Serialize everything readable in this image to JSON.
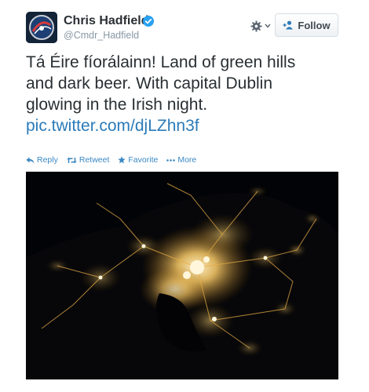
{
  "tweet": {
    "user": {
      "name": "Chris Hadfield",
      "handle": "@Cmdr_Hadfield",
      "verified": true,
      "avatar_icon": "mission-patch-icon"
    },
    "header": {
      "settings_icon": "gear-icon",
      "follow_label": "Follow",
      "follow_icon": "add-user-icon"
    },
    "text_lines": [
      "Tá Éire fíorálainn! Land of green hills",
      "and dark beer. With capital Dublin",
      "glowing in the Irish night."
    ],
    "link": "pic.twitter.com/djLZhn3f",
    "actions": [
      {
        "label": "Reply",
        "icon": "reply-icon"
      },
      {
        "label": "Retweet",
        "icon": "retweet-icon"
      },
      {
        "label": "Favorite",
        "icon": "star-icon"
      },
      {
        "label": "More",
        "icon": "ellipsis-icon"
      }
    ],
    "photo": {
      "subject_icon": "night-city-lights-image"
    },
    "colors": {
      "link": "#2b7bb9",
      "verified": "#2aa1f2",
      "handle": "#8899a6",
      "city_lights": "#ffce72"
    }
  }
}
